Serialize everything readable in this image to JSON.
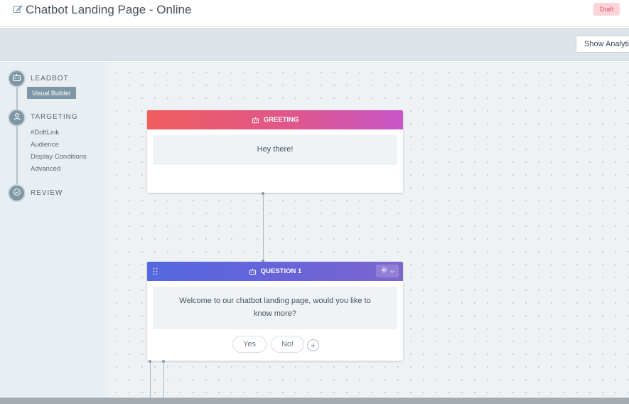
{
  "header": {
    "title": "Chatbot Landing Page - Online",
    "status_badge": "Draft"
  },
  "toolbar": {
    "analytics_button": "Show Analytics"
  },
  "sidebar": {
    "steps": [
      {
        "label": "LEADBOT",
        "icon": "bot-icon",
        "items": [
          "Visual Builder"
        ]
      },
      {
        "label": "TARGETING",
        "icon": "user-icon",
        "items": [
          "#DriftLink",
          "Audience",
          "Display Conditions",
          "Advanced"
        ]
      },
      {
        "label": "REVIEW",
        "icon": "check-icon",
        "items": []
      }
    ]
  },
  "canvas": {
    "greeting": {
      "header": "GREETING",
      "message": "Hey there!"
    },
    "question": {
      "header": "QUESTION 1",
      "message_line1": "Welcome to our chatbot landing page, would you like to",
      "message_line2": "know more?",
      "options": [
        "Yes",
        "No!"
      ],
      "add_label": "+"
    }
  },
  "colors": {
    "greeting_gradient": [
      "#f05d5e",
      "#c857c8"
    ],
    "question_gradient": [
      "#5568e0",
      "#7e66cc"
    ],
    "sidebar_accent": "#7e97a7",
    "draft_badge_bg": "#fbd4d9",
    "draft_badge_text": "#e0566b"
  }
}
